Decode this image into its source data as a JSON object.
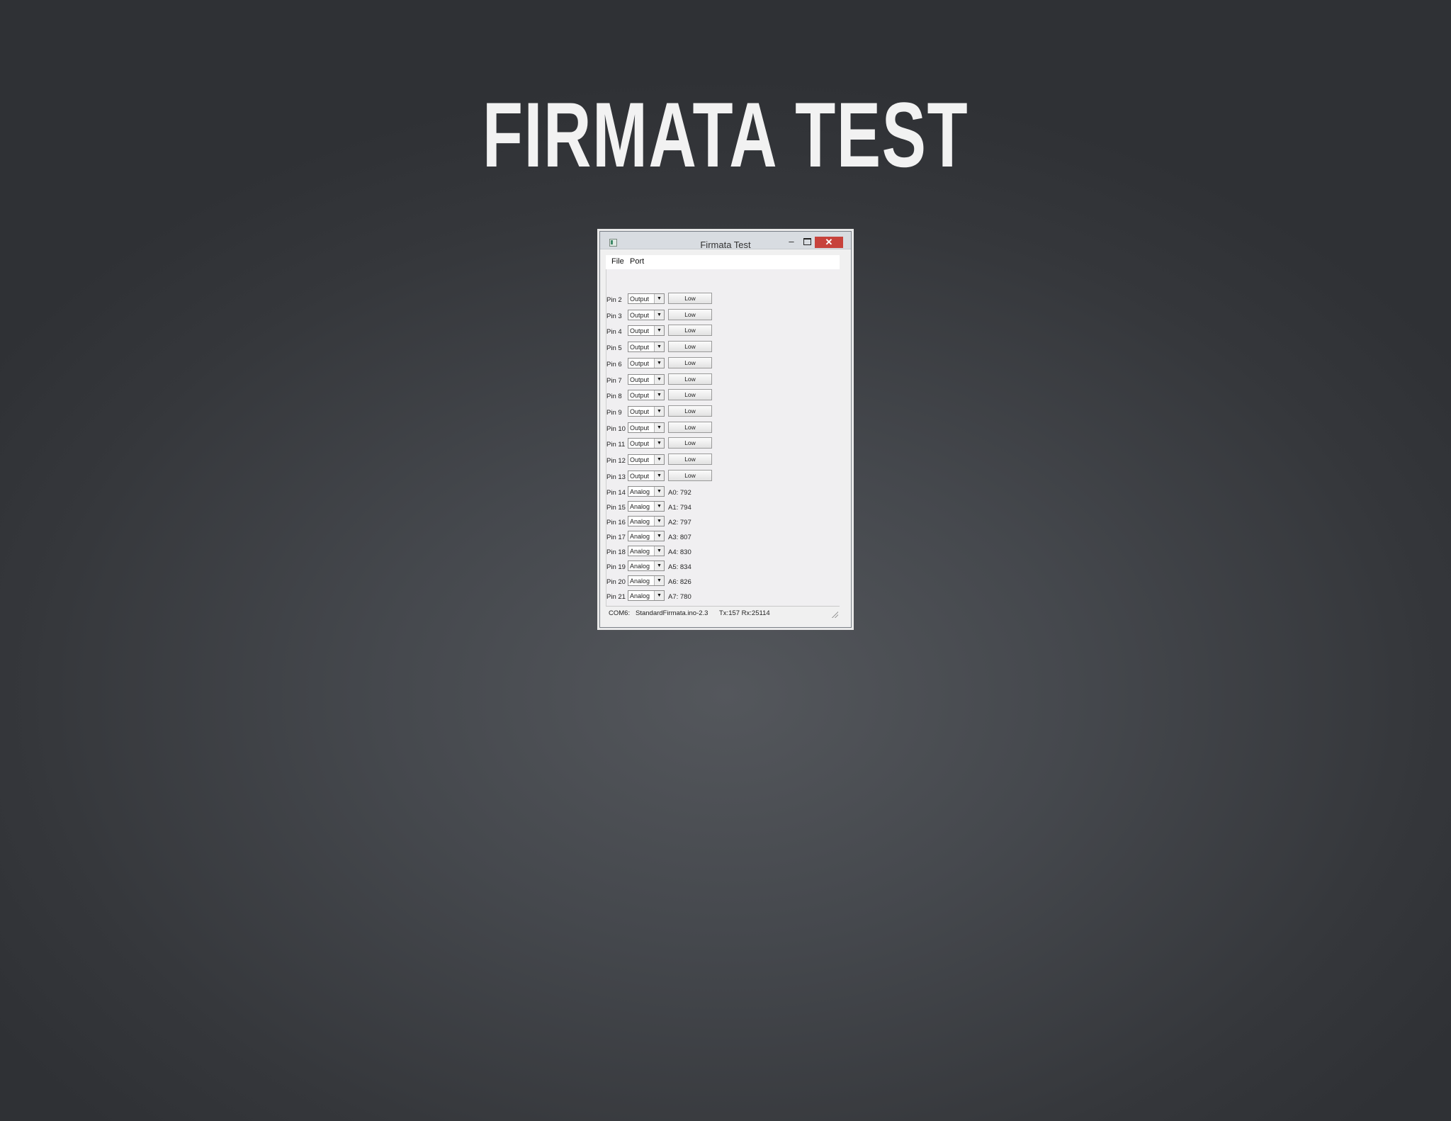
{
  "slide": {
    "title": "FIRMATA TEST"
  },
  "window": {
    "title": "Firmata Test",
    "controls": {
      "minimize": "–",
      "close": "✕"
    }
  },
  "menu": [
    {
      "label": "File"
    },
    {
      "label": "Port"
    }
  ],
  "digital_pins": [
    {
      "label": "Pin 2",
      "mode": "Output",
      "value": "Low"
    },
    {
      "label": "Pin 3",
      "mode": "Output",
      "value": "Low"
    },
    {
      "label": "Pin 4",
      "mode": "Output",
      "value": "Low"
    },
    {
      "label": "Pin 5",
      "mode": "Output",
      "value": "Low"
    },
    {
      "label": "Pin 6",
      "mode": "Output",
      "value": "Low"
    },
    {
      "label": "Pin 7",
      "mode": "Output",
      "value": "Low"
    },
    {
      "label": "Pin 8",
      "mode": "Output",
      "value": "Low"
    },
    {
      "label": "Pin 9",
      "mode": "Output",
      "value": "Low"
    },
    {
      "label": "Pin 10",
      "mode": "Output",
      "value": "Low"
    },
    {
      "label": "Pin 11",
      "mode": "Output",
      "value": "Low"
    },
    {
      "label": "Pin 12",
      "mode": "Output",
      "value": "Low"
    },
    {
      "label": "Pin 13",
      "mode": "Output",
      "value": "Low"
    }
  ],
  "analog_pins": [
    {
      "label": "Pin 14",
      "mode": "Analog",
      "value": "A0: 792"
    },
    {
      "label": "Pin 15",
      "mode": "Analog",
      "value": "A1: 794"
    },
    {
      "label": "Pin 16",
      "mode": "Analog",
      "value": "A2: 797"
    },
    {
      "label": "Pin 17",
      "mode": "Analog",
      "value": "A3: 807"
    },
    {
      "label": "Pin 18",
      "mode": "Analog",
      "value": "A4: 830"
    },
    {
      "label": "Pin 19",
      "mode": "Analog",
      "value": "A5: 834"
    },
    {
      "label": "Pin 20",
      "mode": "Analog",
      "value": "A6: 826"
    },
    {
      "label": "Pin 21",
      "mode": "Analog",
      "value": "A7: 780"
    }
  ],
  "status": {
    "port": "COM6:",
    "firmware": "StandardFirmata.ino-2.3",
    "traffic": "Tx:157 Rx:25114"
  },
  "colors": {
    "close_button": "#c7423c",
    "background": "#3a3c40"
  }
}
